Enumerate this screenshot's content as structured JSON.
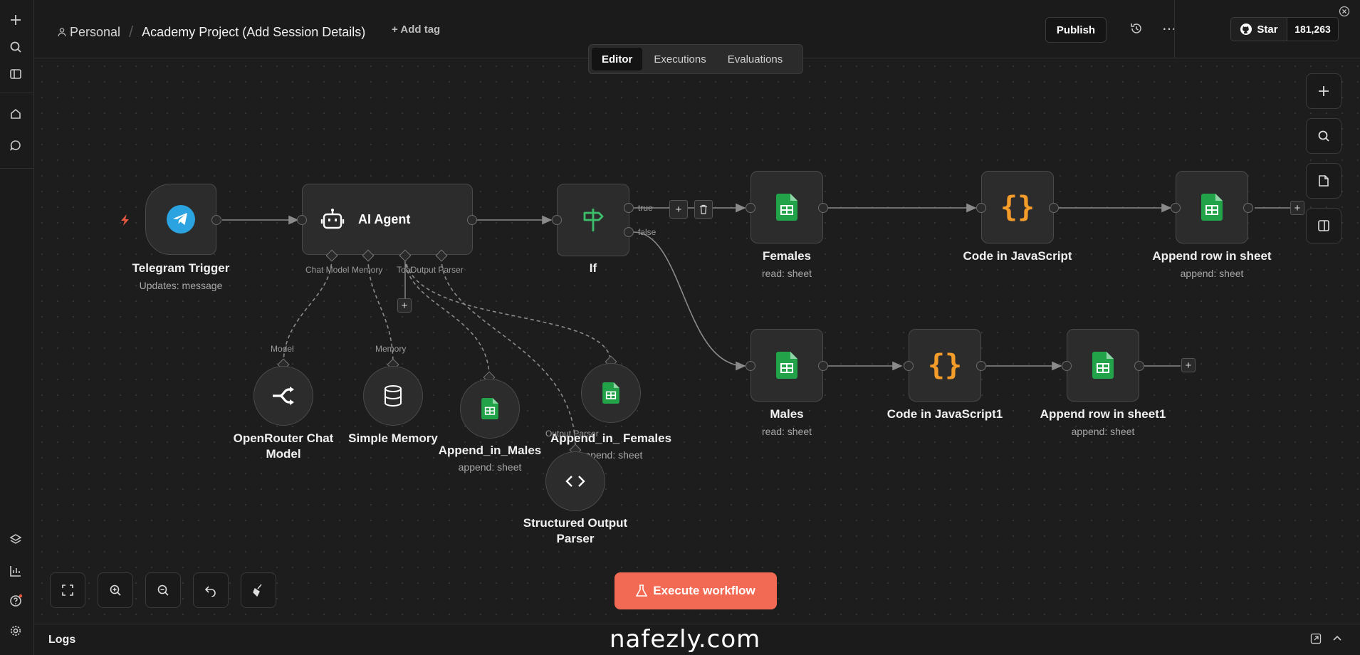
{
  "header": {
    "project_owner": "Personal",
    "workflow_title": "Academy Project (Add Session Details)",
    "add_tag": "+ Add tag",
    "publish": "Publish",
    "star_label": "Star",
    "star_count": "181,263"
  },
  "tabs": [
    {
      "label": "Editor",
      "active": true
    },
    {
      "label": "Executions",
      "active": false
    },
    {
      "label": "Evaluations",
      "active": false
    }
  ],
  "nodes": {
    "telegram": {
      "title": "Telegram Trigger",
      "sub": "Updates: message"
    },
    "agent": {
      "title": "AI Agent",
      "ports": [
        "Chat Model",
        "Memory",
        "Tool",
        "Output Parser"
      ]
    },
    "if": {
      "title": "If",
      "true_label": "true",
      "false_label": "false"
    },
    "females": {
      "title": "Females",
      "sub": "read: sheet"
    },
    "code1": {
      "title": "Code in JavaScript"
    },
    "append1": {
      "title": "Append row in sheet",
      "sub": "append: sheet"
    },
    "males": {
      "title": "Males",
      "sub": "read: sheet"
    },
    "code2": {
      "title": "Code in JavaScript1"
    },
    "append2": {
      "title": "Append row in sheet1",
      "sub": "append: sheet"
    },
    "openrouter": {
      "title": "OpenRouter Chat Model",
      "port_label": "Model"
    },
    "memory": {
      "title": "Simple Memory",
      "port_label": "Memory"
    },
    "append_males": {
      "title": "Append_in_Males",
      "sub": "append: sheet"
    },
    "append_females": {
      "title": "Append_in_ Females",
      "sub": "append: sheet"
    },
    "parser": {
      "title": "Structured Output Parser",
      "port_label": "Output Parser"
    }
  },
  "execute_button": "Execute workflow",
  "logs_label": "Logs",
  "watermark": "nafezly.com",
  "colors": {
    "execute": "#f26a53",
    "sheets_green": "#22a34a",
    "code_orange": "#f39c2a",
    "telegram_blue": "#2aa3e0",
    "trigger_bolt": "#e9573f",
    "if_green": "#3cbf6a"
  }
}
